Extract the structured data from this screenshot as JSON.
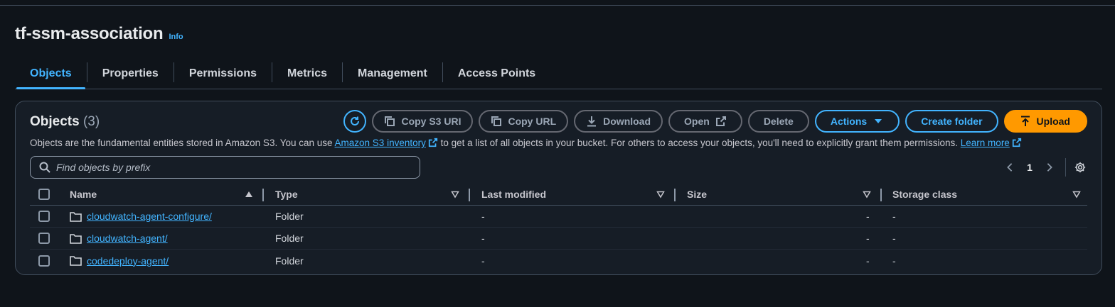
{
  "page": {
    "title": "tf-ssm-association",
    "info_label": "Info"
  },
  "tabs": [
    {
      "label": "Objects",
      "active": true
    },
    {
      "label": "Properties",
      "active": false
    },
    {
      "label": "Permissions",
      "active": false
    },
    {
      "label": "Metrics",
      "active": false
    },
    {
      "label": "Management",
      "active": false
    },
    {
      "label": "Access Points",
      "active": false
    }
  ],
  "objects_panel": {
    "title": "Objects",
    "count": "(3)",
    "description_before": "Objects are the fundamental entities stored in Amazon S3. You can use ",
    "inventory_link": "Amazon S3 inventory",
    "description_after": " to get a list of all objects in your bucket. For others to access your objects, you'll need to explicitly grant them permissions. ",
    "learn_more": "Learn more"
  },
  "toolbar": {
    "refresh_icon": "refresh-icon",
    "copy_s3_uri": "Copy S3 URI",
    "copy_url": "Copy URL",
    "download": "Download",
    "open": "Open",
    "delete": "Delete",
    "actions": "Actions",
    "create_folder": "Create folder",
    "upload": "Upload"
  },
  "search": {
    "placeholder": "Find objects by prefix",
    "value": ""
  },
  "pagination": {
    "current_page": "1"
  },
  "table": {
    "columns": [
      "Name",
      "Type",
      "Last modified",
      "Size",
      "Storage class"
    ],
    "rows": [
      {
        "name": "cloudwatch-agent-configure/",
        "type": "Folder",
        "last_modified": "-",
        "size": "-",
        "storage_class": "-"
      },
      {
        "name": "cloudwatch-agent/",
        "type": "Folder",
        "last_modified": "-",
        "size": "-",
        "storage_class": "-"
      },
      {
        "name": "codedeploy-agent/",
        "type": "Folder",
        "last_modified": "-",
        "size": "-",
        "storage_class": "-"
      }
    ]
  },
  "colors": {
    "background": "#0f141a",
    "panel": "#161d26",
    "accent": "#42b4ff",
    "upload": "#ff9900",
    "border": "#414d5c"
  }
}
